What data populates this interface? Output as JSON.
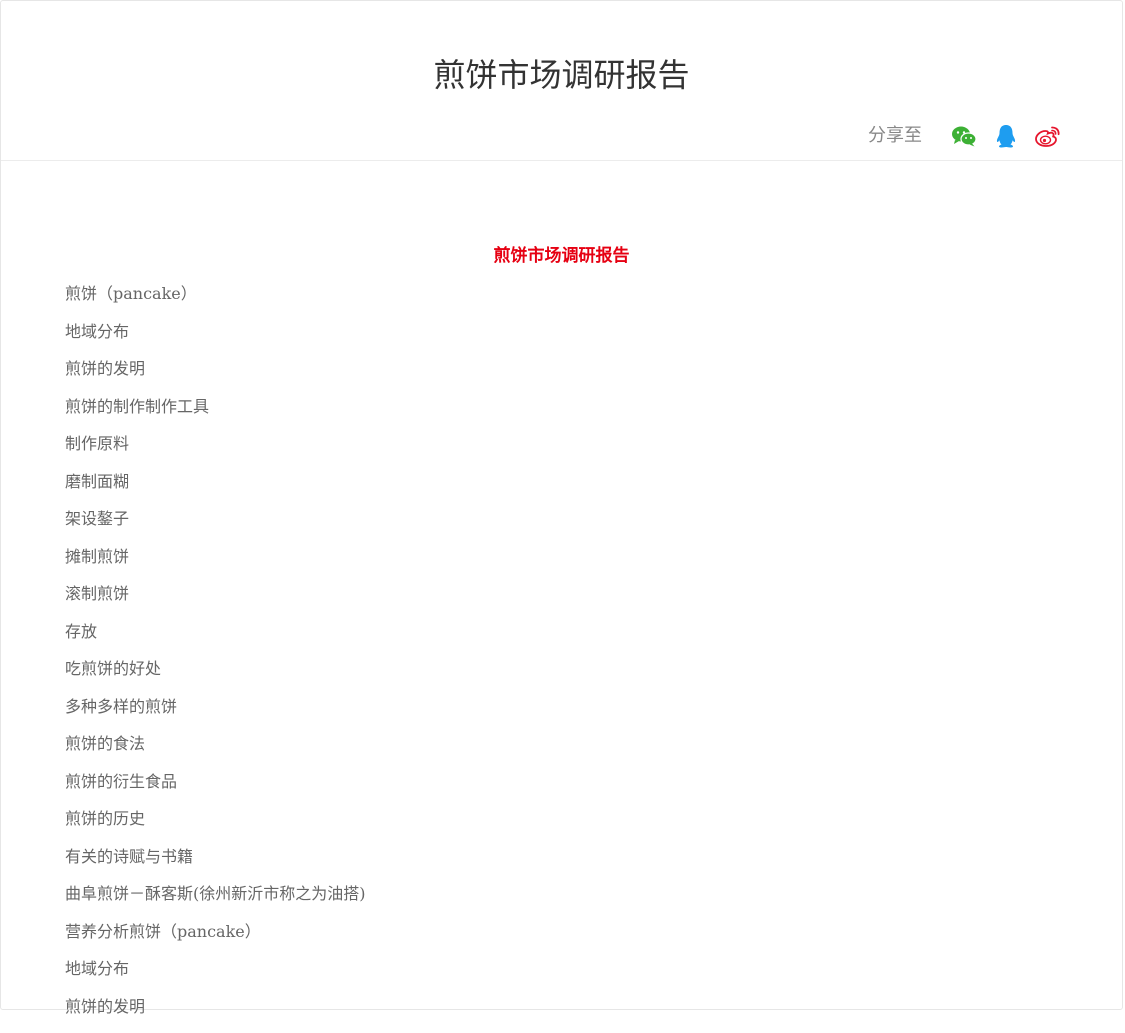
{
  "header": {
    "title": "煎饼市场调研报告",
    "share_label": "分享至",
    "share_icons": [
      "wechat-icon",
      "qq-icon",
      "weibo-icon"
    ],
    "colors": {
      "wechat": "#3cb034",
      "qq": "#1e9df0",
      "weibo": "#e6162d"
    }
  },
  "document": {
    "title": "煎饼市场调研报告",
    "title_color": "#e60012",
    "items": [
      "煎饼（pancake）",
      "地域分布",
      "煎饼的发明",
      "煎饼的制作制作工具",
      "制作原料",
      "磨制面糊",
      "架设鏊子",
      "摊制煎饼",
      "滚制煎饼",
      "存放",
      "吃煎饼的好处",
      "多种多样的煎饼",
      "煎饼的食法",
      "煎饼的衍生食品",
      "煎饼的历史",
      "有关的诗赋与书籍",
      "曲阜煎饼－酥客斯(徐州新沂市称之为油搭)",
      "营养分析煎饼（pancake）",
      "地域分布",
      "煎饼的发明"
    ]
  }
}
